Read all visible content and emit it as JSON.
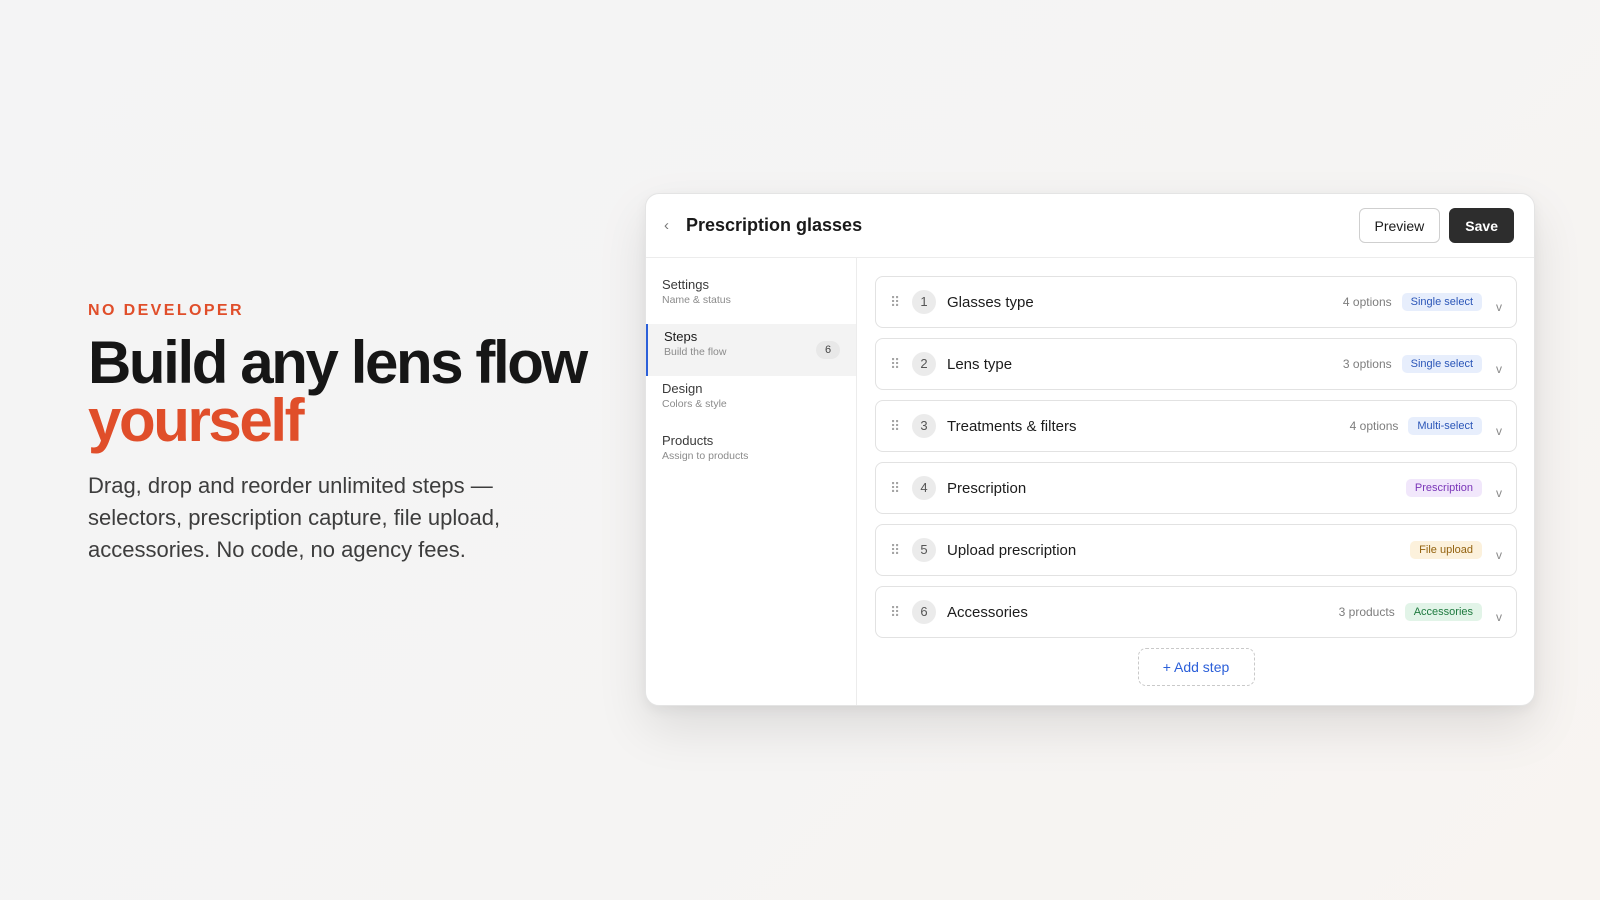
{
  "hero": {
    "eyebrow": "NO DEVELOPER",
    "headline_line1": "Build any lens flow",
    "headline_line2": "yourself",
    "subtext": "Drag, drop and reorder unlimited steps — selectors, prescription capture, file upload, accessories. No code, no agency fees."
  },
  "window": {
    "back_icon": "chevron-left-icon",
    "title": "Prescription glasses",
    "preview_label": "Preview",
    "save_label": "Save"
  },
  "sidebar": {
    "items": [
      {
        "label": "Settings",
        "sub": "Name & status"
      },
      {
        "label": "Steps",
        "sub": "Build the flow",
        "count": "6",
        "active": true
      },
      {
        "label": "Design",
        "sub": "Colors & style"
      },
      {
        "label": "Products",
        "sub": "Assign to products"
      }
    ]
  },
  "steps": [
    {
      "num": "1",
      "name": "Glasses type",
      "meta": "4 options",
      "badge": "Single select"
    },
    {
      "num": "2",
      "name": "Lens type",
      "meta": "3 options",
      "badge": "Single select"
    },
    {
      "num": "3",
      "name": "Treatments & filters",
      "meta": "4 options",
      "badge": "Multi-select"
    },
    {
      "num": "4",
      "name": "Prescription",
      "meta": "",
      "badge": "Prescription"
    },
    {
      "num": "5",
      "name": "Upload prescription",
      "meta": "",
      "badge": "File upload"
    },
    {
      "num": "6",
      "name": "Accessories",
      "meta": "3 products",
      "badge": "Accessories"
    }
  ],
  "step_glyphs": {
    "drag": "⠿",
    "chevron": "v",
    "back": "‹"
  },
  "add_step_label": "+ Add step",
  "colors": {
    "accent": "#e04e2a",
    "active_indicator": "#2b5fd9",
    "save_button": "#2d2d2d"
  }
}
